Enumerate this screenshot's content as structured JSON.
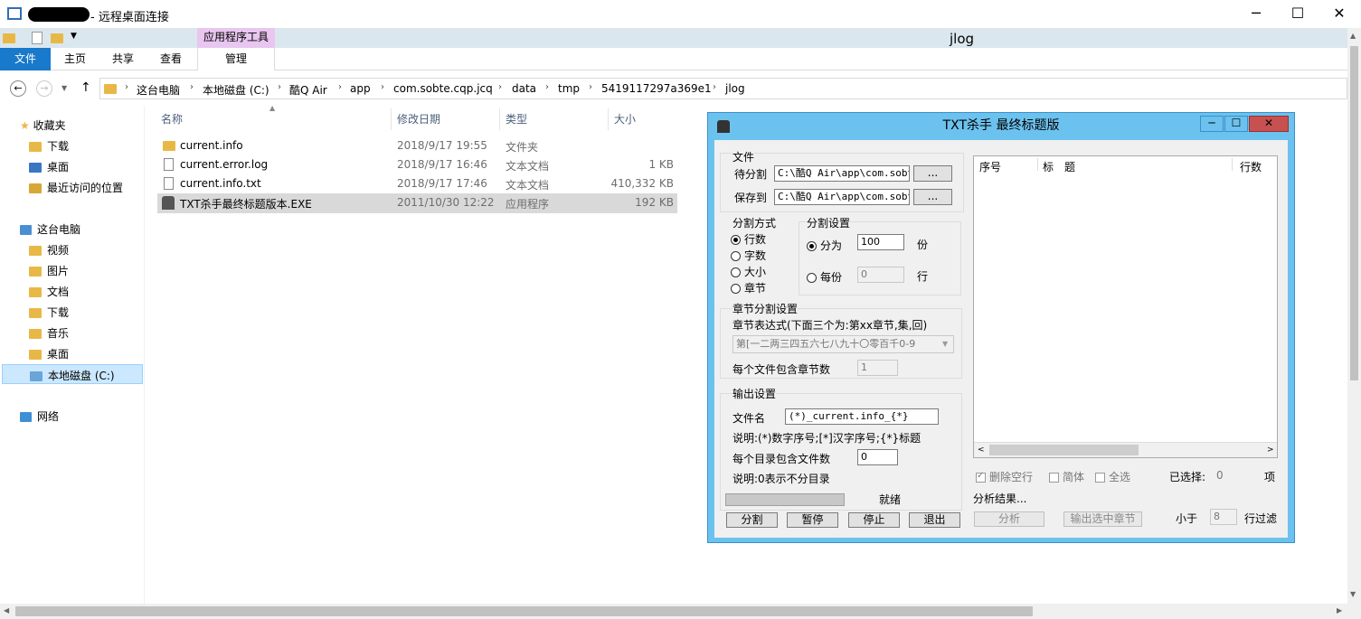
{
  "window": {
    "title": "- 远程桌面连接",
    "min": "─",
    "max": "☐",
    "close": "✕"
  },
  "ribbon": {
    "context_label": "应用程序工具",
    "window_title": "jlog",
    "tabs": [
      "文件",
      "主页",
      "共享",
      "查看",
      "管理"
    ]
  },
  "address": {
    "crumbs": [
      "这台电脑",
      "本地磁盘 (C:)",
      "酷Q Air",
      "app",
      "com.sobte.cqp.jcq",
      "data",
      "tmp",
      "5419117297a369e1",
      "jlog"
    ]
  },
  "nav": {
    "favorites": "收藏夹",
    "fav_items": [
      "下载",
      "桌面",
      "最近访问的位置"
    ],
    "pc": "这台电脑",
    "pc_items": [
      "视频",
      "图片",
      "文档",
      "下载",
      "音乐",
      "桌面",
      "本地磁盘 (C:)"
    ],
    "network": "网络"
  },
  "files": {
    "headers": [
      "名称",
      "修改日期",
      "类型",
      "大小"
    ],
    "rows": [
      {
        "name": "current.info",
        "date": "2018/9/17 19:55",
        "type": "文件夹",
        "size": ""
      },
      {
        "name": "current.error.log",
        "date": "2018/9/17 16:46",
        "type": "文本文档",
        "size": "1 KB"
      },
      {
        "name": "current.info.txt",
        "date": "2018/9/17 17:46",
        "type": "文本文档",
        "size": "410,332 KB"
      },
      {
        "name": "TXT杀手最终标题版本.EXE",
        "date": "2011/10/30 12:22",
        "type": "应用程序",
        "size": "192 KB"
      }
    ]
  },
  "dialog": {
    "title": "TXT杀手 最终标题版",
    "file_group": "文件",
    "split_src_label": "待分割",
    "split_src_value": "C:\\酷Q Air\\app\\com.sobte",
    "save_label": "保存到",
    "save_value": "C:\\酷Q Air\\app\\com.sobte",
    "browse": "...",
    "mode_group": "分割方式",
    "modes": [
      "行数",
      "字数",
      "大小",
      "章节"
    ],
    "setting_group": "分割设置",
    "opt_parts": "分为",
    "parts_value": "100",
    "parts_unit": "份",
    "opt_each": "每份",
    "each_value": "0",
    "each_unit": "行",
    "chapter_group": "章节分割设置",
    "chapter_expr_label": "章节表达式(下面三个为:第xx章节,集,回)",
    "chapter_expr_value": "第[一二两三四五六七八九十〇零百千0-9",
    "chapter_per_file_label": "每个文件包含章节数",
    "chapter_per_file_value": "1",
    "output_group": "输出设置",
    "filename_label": "文件名",
    "filename_value": "(*)_current.info_{*}",
    "note1": "说明:(*)数字序号;[*]汉字序号;{*}标题",
    "per_dir_label": "每个目录包含文件数",
    "per_dir_value": "0",
    "note2": "说明:0表示不分目录",
    "status": "就绪",
    "buttons": [
      "分割",
      "暂停",
      "停止",
      "退出"
    ],
    "list_headers": [
      "序号",
      "标　题",
      "行数"
    ],
    "chk_delete_empty": "删除空行",
    "chk_simplified": "简体",
    "chk_all": "全选",
    "selected_label": "已选择:",
    "selected_count": "0",
    "selected_unit": "项",
    "analysis_label": "分析结果...",
    "analyze_btn": "分析",
    "export_btn": "输出选中章节",
    "less_than": "小于",
    "filter_value": "8",
    "filter_label": "行过滤"
  }
}
